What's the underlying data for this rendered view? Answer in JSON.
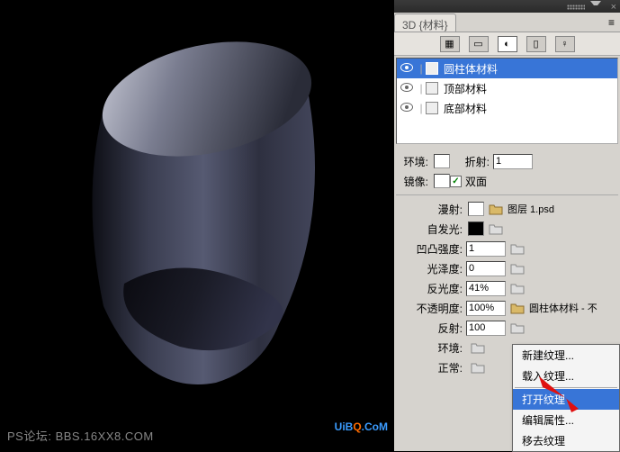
{
  "panel": {
    "title": "3D {材料}",
    "modes": [
      "scene",
      "mesh",
      "material",
      "light",
      "bulb"
    ],
    "materials": [
      {
        "name": "圆柱体材料",
        "selected": true
      },
      {
        "name": "顶部材料",
        "selected": false
      },
      {
        "name": "底部材料",
        "selected": false
      }
    ],
    "rows": {
      "env_label": "环境:",
      "refraction_label": "折射:",
      "refraction_value": "1",
      "mirror_label": "镜像:",
      "double_face_label": "双面",
      "double_face_checked": "✓",
      "diffuse_label": "漫射:",
      "diffuse_texture": "图层 1.psd",
      "selfillum_label": "自发光:",
      "bump_label": "凹凸强度:",
      "bump_value": "1",
      "gloss_label": "光泽度:",
      "gloss_value": "0",
      "spec_label": "反光度:",
      "spec_value": "41%",
      "opacity_label": "不透明度:",
      "opacity_value": "100%",
      "opacity_texture": "圆柱体材料 - 不",
      "reflect_label": "反射:",
      "reflect_value": "100",
      "env2_label": "环境:",
      "normal_label": "正常:"
    },
    "ctx": {
      "new": "新建纹理...",
      "load": "载入纹理...",
      "open": "打开纹理",
      "edit": "编辑属性...",
      "remove": "移去纹理"
    }
  },
  "watermark": {
    "line1": "PS论坛: BBS.16XX8.COM",
    "line2a": "UiB",
    "line2b": "Q",
    "line2c": ".CoM"
  }
}
